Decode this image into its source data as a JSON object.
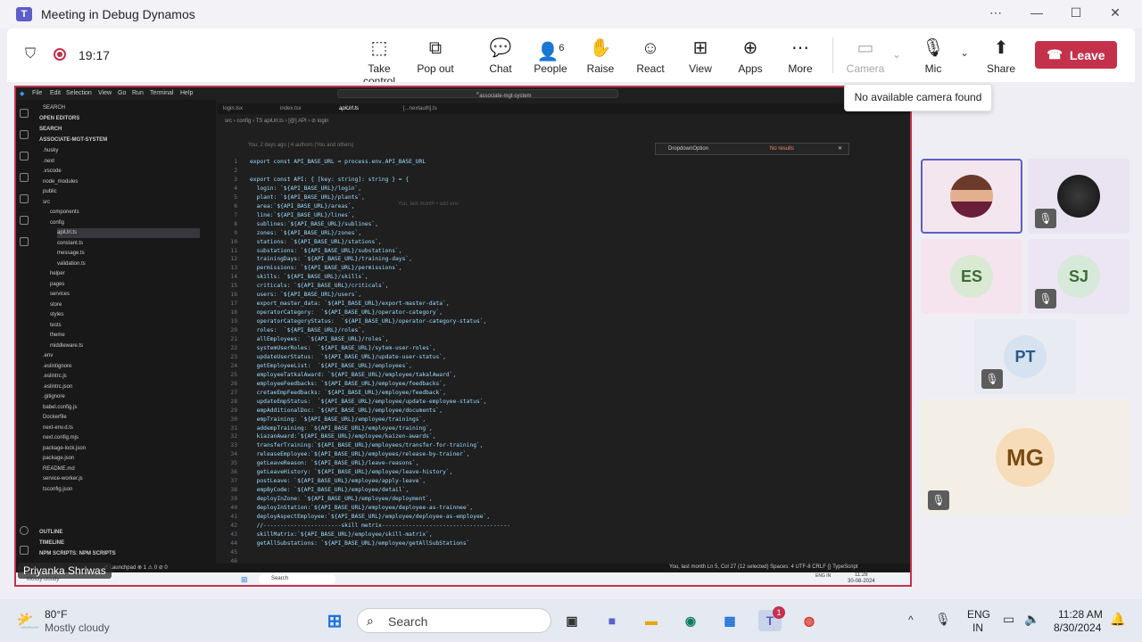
{
  "window": {
    "title": "Meeting in Debug Dynamos",
    "logo_letter": "T"
  },
  "toolbar": {
    "timer": "19:17",
    "buttons": {
      "take_control": "Take control",
      "pop_out": "Pop out",
      "chat": "Chat",
      "people": "People",
      "people_count": "6",
      "raise": "Raise",
      "react": "React",
      "view": "View",
      "apps": "Apps",
      "more": "More",
      "camera": "Camera",
      "mic": "Mic",
      "share": "Share"
    },
    "leave": "Leave",
    "tooltip": "No available camera found"
  },
  "vscode": {
    "menu": [
      "File",
      "Edit",
      "Selection",
      "View",
      "Go",
      "Run",
      "Terminal",
      "Help"
    ],
    "search": "associate-mgt-system",
    "tabs": [
      "login.tsx",
      "index.tsx",
      "apiUrl.ts",
      "[...nextauth].ts"
    ],
    "breadcrumb": "src › config › TS apiUrl.ts › [@] API › ⊘ login",
    "find_text": "DropdownOption",
    "find_result": "No results",
    "blame": "You, 2 days ago | 4 authors (You and others)",
    "inline_blame": "You, last month • add env",
    "sidebar_sections": [
      "SEARCH",
      "OPEN EDITORS",
      "SEARCH",
      "ASSOCIATE-MGT-SYSTEM"
    ],
    "tree": [
      ".husky",
      ".next",
      ".vscode",
      "node_modules",
      "public",
      "src",
      "components",
      "config",
      "apiUrl.ts",
      "constant.ts",
      "message.ts",
      "validation.ts",
      "helper",
      "pages",
      "services",
      "store",
      "styles",
      "tests",
      "theme",
      "middleware.ts",
      ".env",
      ".eslintignore",
      ".eslintrc.js",
      ".eslintrc.json",
      ".gitignore",
      "babel.config.js",
      "Dockerfile",
      "next-env.d.ts",
      "next.config.mjs",
      "package-lock.json",
      "package.json",
      "README.md",
      "service-worker.js",
      "tsconfig.json"
    ],
    "bottom_sections": [
      "OUTLINE",
      "TIMELINE",
      "NPM SCRIPTS: NPM SCRIPTS"
    ],
    "status_left": "⎇ Launchpad  ⊗ 1 ⚠ 0  ⊘ 0",
    "status_right": "You, last month   Ln 5, Col 27 (12 selected)   Spaces: 4   UTF-8   CRLF   {} TypeScript",
    "inner_weather": "Mostly cloudy",
    "inner_search": "Search",
    "inner_time": "11:28",
    "inner_date": "30-08-2024",
    "inner_lang": "ENG IN",
    "code": [
      {
        "n": "1",
        "t": "export const API_BASE_URL = process.env.API_BASE_URL"
      },
      {
        "n": "2",
        "t": ""
      },
      {
        "n": "3",
        "t": "export const API: { [key: string]: string } = {"
      },
      {
        "n": "4",
        "t": "  login: `${API_BASE_URL}/login`,"
      },
      {
        "n": "5",
        "t": "  plant: `${API_BASE_URL}/plants`,"
      },
      {
        "n": "6",
        "t": "  area:`${API_BASE_URL}/areas`,"
      },
      {
        "n": "7",
        "t": "  line:`${API_BASE_URL}/lines`,"
      },
      {
        "n": "8",
        "t": "  sublines:`${API_BASE_URL}/sublines`,"
      },
      {
        "n": "9",
        "t": "  zones: `${API_BASE_URL}/zones`,"
      },
      {
        "n": "10",
        "t": "  stations: `${API_BASE_URL}/stations`,"
      },
      {
        "n": "11",
        "t": "  substations: `${API_BASE_URL}/substations`,"
      },
      {
        "n": "12",
        "t": "  trainingDays: `${API_BASE_URL}/training-days`,"
      },
      {
        "n": "13",
        "t": "  permissions: `${API_BASE_URL}/permissions`,"
      },
      {
        "n": "14",
        "t": "  skills: `${API_BASE_URL}/skills`,"
      },
      {
        "n": "15",
        "t": "  criticals: `${API_BASE_URL}/criticals`,"
      },
      {
        "n": "16",
        "t": "  users: `${API_BASE_URL}/users`,"
      },
      {
        "n": "17",
        "t": "  export_master_data: `${API_BASE_URL}/export-master-data`,"
      },
      {
        "n": "18",
        "t": "  operatorCategory:  `${API_BASE_URL}/operator-category`,"
      },
      {
        "n": "19",
        "t": "  operatorCategoryStatus:  `${API_BASE_URL}/operator-category-status`,"
      },
      {
        "n": "20",
        "t": "  roles:  `${API_BASE_URL}/roles`,"
      },
      {
        "n": "21",
        "t": "  allEmployees:  `${API_BASE_URL}/roles`,"
      },
      {
        "n": "22",
        "t": "  systemUserRoles:  `${API_BASE_URL}/sytem-user-roles`,"
      },
      {
        "n": "23",
        "t": "  updateUserStatus:  `${API_BASE_URL}/update-user-status`,"
      },
      {
        "n": "24",
        "t": "  getEmployeeList:  `${API_BASE_URL}/employees`,"
      },
      {
        "n": "25",
        "t": "  employeeTatkalAward: `${API_BASE_URL}/employee/takalAward`,"
      },
      {
        "n": "26",
        "t": "  employeeFeedbacks: `${API_BASE_URL}/employee/feedbacks`,"
      },
      {
        "n": "27",
        "t": "  cretaeEmpFeedbacks: `${API_BASE_URL}/employee/feedback`,"
      },
      {
        "n": "28",
        "t": "  updateEmpStatus:  `${API_BASE_URL}/employee/update-employee-status`,"
      },
      {
        "n": "29",
        "t": "  empAdditionalDoc: `${API_BASE_URL}/employee/documents`,"
      },
      {
        "n": "30",
        "t": "  empTraining: `${API_BASE_URL}/employee/trainings`,"
      },
      {
        "n": "31",
        "t": "  addempTraining: `${API_BASE_URL}/employee/training`,"
      },
      {
        "n": "32",
        "t": "  kiazanAward:`${API_BASE_URL}/employee/kaizen-awards`,"
      },
      {
        "n": "33",
        "t": "  transferTraining:`${API_BASE_URL}/employees/transfer-for-training`,"
      },
      {
        "n": "34",
        "t": "  releaseEmployee:`${API_BASE_URL}/employees/release-by-trainer`,"
      },
      {
        "n": "35",
        "t": "  getLeaveReason: `${API_BASE_URL}/leave-reasons`,"
      },
      {
        "n": "36",
        "t": "  getLeaveHistory: `${API_BASE_URL}/employee/leave-history`,"
      },
      {
        "n": "37",
        "t": "  postLeave: `${API_BASE_URL}/employee/apply-leave`,"
      },
      {
        "n": "38",
        "t": "  empByCode: `${API_BASE_URL}/employee/detail`,"
      },
      {
        "n": "39",
        "t": "  deployInZone: `${API_BASE_URL}/employee/deployment`,"
      },
      {
        "n": "40",
        "t": "  deployInStation:`${API_BASE_URL}/employee/deployee-as-trainnee`,"
      },
      {
        "n": "41",
        "t": "  deployAspectEmployee:`${API_BASE_URL}/employee/deployee-as-employee`,"
      },
      {
        "n": "42",
        "t": "  //-----------------------skill metrix--------------------------------------"
      },
      {
        "n": "43",
        "t": "  skillMatrix:`${API_BASE_URL}/employee/skill-matrix`,"
      },
      {
        "n": "44",
        "t": "  getAllSubstations: `${API_BASE_URL}/employee/getAllSubStations`"
      },
      {
        "n": "45",
        "t": ""
      },
      {
        "n": "46",
        "t": ""
      }
    ]
  },
  "presenter": "Priyanka Shriwas",
  "participants": [
    {
      "initials": "",
      "kind": "photo",
      "muted": false,
      "selected": true,
      "bg": "#f3e6ef"
    },
    {
      "initials": "",
      "kind": "photo-dark",
      "muted": true,
      "selected": false,
      "bg": "#eae4f2"
    },
    {
      "initials": "ES",
      "kind": "initials",
      "muted": false,
      "selected": false,
      "bg": "#f5e4ee"
    },
    {
      "initials": "SJ",
      "kind": "initials",
      "muted": true,
      "selected": false,
      "bg": "#ece6f4"
    },
    {
      "initials": "PT",
      "kind": "initials",
      "muted": true,
      "selected": false,
      "bg": "#e8ecf2"
    },
    {
      "initials": "MG",
      "kind": "initials",
      "muted": true,
      "selected": false,
      "bg": "#f4efe6"
    }
  ],
  "taskbar": {
    "weather_temp": "80°F",
    "weather_desc": "Mostly cloudy",
    "search": "Search",
    "teams_badge": "1",
    "lang_1": "ENG",
    "lang_2": "IN",
    "time": "11:28 AM",
    "date": "8/30/2024"
  },
  "colors": {
    "accent": "#5b5fc7",
    "leave": "#c4314b",
    "share_border": "#c4314b"
  }
}
